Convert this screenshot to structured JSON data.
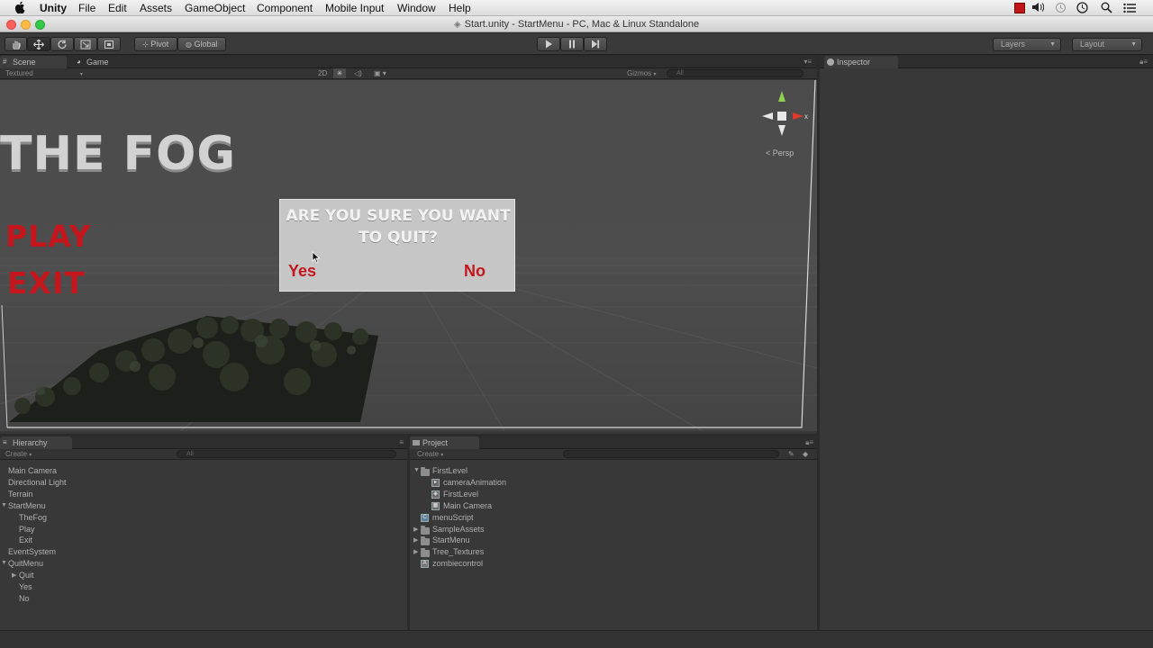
{
  "menubar": {
    "apple": "",
    "items": [
      "Unity",
      "File",
      "Edit",
      "Assets",
      "GameObject",
      "Component",
      "Mobile Input",
      "Window",
      "Help"
    ]
  },
  "window": {
    "title": "Start.unity - StartMenu - PC, Mac & Linux Standalone"
  },
  "toolbar": {
    "pivot": "Pivot",
    "global": "Global",
    "layers": "Layers",
    "layout": "Layout"
  },
  "scene_panel": {
    "tabs": [
      "Scene",
      "Game"
    ],
    "shading": "Textured",
    "mode_2d": "2D",
    "gizmos": "Gizmos",
    "search_placeholder": "All",
    "persp": "Persp",
    "axis_x": "x",
    "game_title": "THE FOG",
    "play": "PLAY",
    "exit": "EXIT",
    "dialog": {
      "question_line1": "ARE YOU SURE YOU WANT",
      "question_line2": "TO QUIT?",
      "yes": "Yes",
      "no": "No"
    }
  },
  "inspector": {
    "tab": "Inspector"
  },
  "hierarchy": {
    "tab": "Hierarchy",
    "create": "Create",
    "search_placeholder": "All",
    "items": [
      {
        "label": "Main Camera",
        "indent": 0
      },
      {
        "label": "Directional Light",
        "indent": 0
      },
      {
        "label": "Terrain",
        "indent": 0
      },
      {
        "label": "StartMenu",
        "indent": 0,
        "expanded": true
      },
      {
        "label": "TheFog",
        "indent": 1
      },
      {
        "label": "Play",
        "indent": 1
      },
      {
        "label": "Exit",
        "indent": 1
      },
      {
        "label": "EventSystem",
        "indent": 0
      },
      {
        "label": "QuitMenu",
        "indent": 0,
        "expanded": true
      },
      {
        "label": "Quit",
        "indent": 1,
        "collapsed": true
      },
      {
        "label": "Yes",
        "indent": 1
      },
      {
        "label": "No",
        "indent": 1
      }
    ]
  },
  "project": {
    "tab": "Project",
    "create": "Create",
    "items": [
      {
        "label": "FirstLevel",
        "icon": "folder-icon",
        "indent": 0,
        "expanded": true
      },
      {
        "label": "cameraAnimation",
        "icon": "animation-icon",
        "indent": 1
      },
      {
        "label": "FirstLevel",
        "icon": "unity-scene-icon",
        "indent": 1
      },
      {
        "label": "Main Camera",
        "icon": "prefab-icon",
        "indent": 1
      },
      {
        "label": "menuScript",
        "icon": "script-icon",
        "indent": 0
      },
      {
        "label": "SampleAssets",
        "icon": "folder-icon",
        "indent": 0
      },
      {
        "label": "StartMenu",
        "icon": "folder-icon",
        "indent": 0
      },
      {
        "label": "Tree_Textures",
        "icon": "folder-icon",
        "indent": 0
      },
      {
        "label": "zombiecontrol",
        "icon": "animator-icon",
        "indent": 0
      }
    ]
  },
  "colors": {
    "menu_red": "#c4161c",
    "dialog_bg": "#c8c8c8",
    "fog_text": "#d9d9d9"
  }
}
